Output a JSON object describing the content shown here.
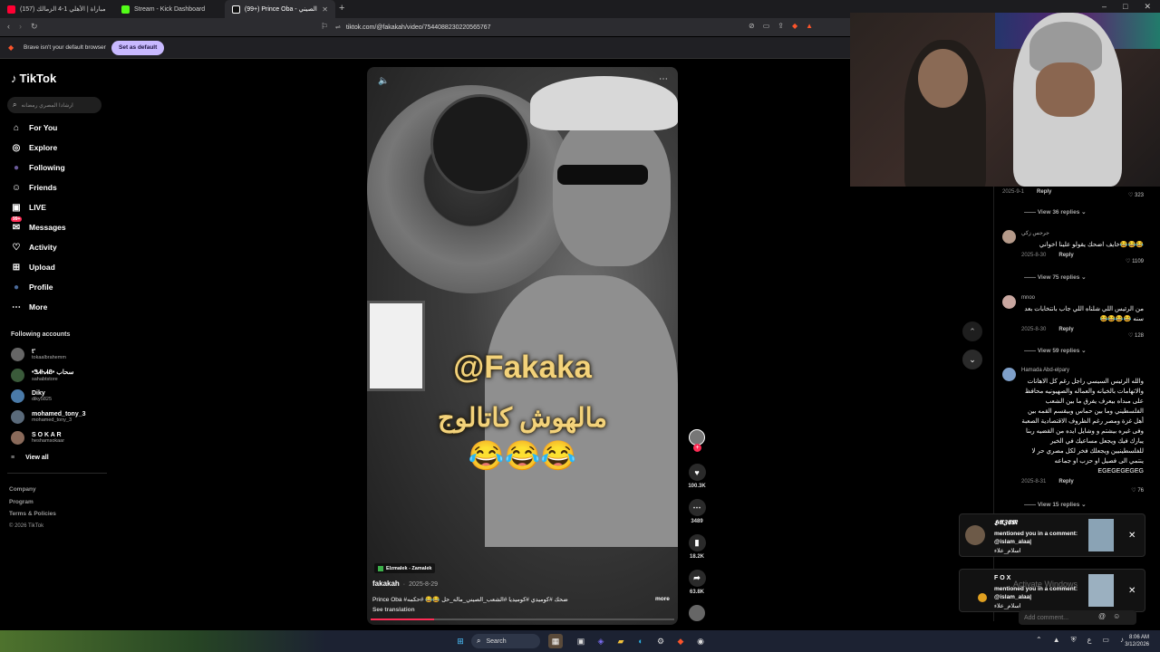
{
  "tabs": [
    {
      "label": "(157) ملخص مباراة | الأهلي 1-4 الزمالك",
      "color": "#ff0033"
    },
    {
      "label": "Stream - Kick Dashboard",
      "color": "#53fc18"
    },
    {
      "label": "(99+) Prince Oba - الشعب الصيني",
      "color": "#ffffff"
    }
  ],
  "url": "tiktok.com/@fakakah/video/7544088230220565767",
  "infobar": {
    "message": "Brave isn't your default browser",
    "button": "Set as default"
  },
  "tiktok": {
    "logo": "TikTok",
    "search_placeholder": "ارشادا المصري رمضانه",
    "nav": [
      {
        "label": "For You",
        "icon": "home-icon",
        "glyph": "⌂"
      },
      {
        "label": "Explore",
        "icon": "compass-icon",
        "glyph": "◎"
      },
      {
        "label": "Following",
        "icon": "following-avatar-icon",
        "glyph": "●"
      },
      {
        "label": "Friends",
        "icon": "friends-icon",
        "glyph": "☺"
      },
      {
        "label": "LIVE",
        "icon": "live-icon",
        "glyph": "▣"
      },
      {
        "label": "Messages",
        "icon": "messages-icon",
        "glyph": "✉",
        "badge": "99+"
      },
      {
        "label": "Activity",
        "icon": "activity-icon",
        "glyph": "♡"
      },
      {
        "label": "Upload",
        "icon": "upload-icon",
        "glyph": "⊞"
      },
      {
        "label": "Profile",
        "icon": "profile-icon",
        "glyph": "●"
      },
      {
        "label": "More",
        "icon": "more-icon",
        "glyph": "⋯"
      }
    ],
    "following_title": "Following accounts",
    "accounts": [
      {
        "name": "t'",
        "user": "tokaalbrahemm"
      },
      {
        "name": "•ᏕᏗᏂᏗᏰ• سحاب",
        "user": "sahabtstore"
      },
      {
        "name": "Diky",
        "user": "diky5825"
      },
      {
        "name": "mohamed_tony_3",
        "user": "mohamed_tony_3"
      },
      {
        "name": "S O K A R",
        "user": "heshamsokaar"
      }
    ],
    "view_all": "View all",
    "footer": [
      "Company",
      "Program",
      "Terms & Policies",
      "© 2026 TikTok"
    ]
  },
  "video": {
    "overlay_line1": "@Fakaka",
    "overlay_line2": "مالهوش كاتالوج",
    "overlay_emoji": "😂😂😂",
    "sticker": "Elzmalek - Zamalek",
    "author": "fakakah",
    "date": "2025-8-29",
    "caption": "Prince Oba #ضحك #كوميدي #كوميديا #الشعب_الصيني_ماله_حل 😂😂 #حكمه",
    "more": "more",
    "see_translation": "See translation",
    "likes": "100.3K",
    "comments": "3489",
    "saves": "18.2K",
    "shares": "63.8K"
  },
  "comments": {
    "top": {
      "date": "2025-9-1",
      "reply": "Reply",
      "likes": "323",
      "view_replies": "View 36 replies"
    },
    "items": [
      {
        "name": "جرجس زكي",
        "text": "😂😂😂خايف اضحك يقولو علينا اخواني",
        "date": "2025-8-30",
        "reply": "Reply",
        "likes": "1109",
        "view_replies": "View 75 replies"
      },
      {
        "name": "mnoo",
        "text": "من الرئيس اللي شلناه اللي جاب بانتخابات بعد سنه 😂😂😂😂",
        "date": "2025-8-30",
        "reply": "Reply",
        "likes": "128",
        "view_replies": "View 59 replies"
      },
      {
        "name": "Hamada Abd-elpary",
        "text": "والله الرئيس السيسي راجل رغم كل الاهانات والاتهامات بالخيانه والعماله والصهيونيه محافظ على مبداه بيعرف يفرق ما بين الشعب الفلسطيني وما بين حماس وبيقسم القمه بين أهل غزة ومصر رغم الظروف الاقتصادية الصعبة وفى غيره بيشتم و وشايل ايده من القضيه ربنا يبارك فيك ويجعل مساعيك في الخير للفلسطينيين ويجعلك فخر لكل مصري حر لا ينتمي الى فصيل او حزب او جماعه EGEGEGEGEG",
        "date": "2025-8-31",
        "reply": "Reply",
        "likes": "76",
        "view_replies": "View 15 replies"
      }
    ],
    "add_placeholder": "Add comment..."
  },
  "notifications": [
    {
      "name": "𝕳𝕬𝖅𝕰𝕸",
      "text": "mentioned you in a comment: @islam_alaa|",
      "sub": "اسلام_علاء"
    },
    {
      "name": "F O X",
      "text": "mentioned you in a comment: @islam_alaa|",
      "sub": "اسلام_علاء"
    }
  ],
  "watermark": "Activate Windows",
  "taskbar": {
    "search": "Search",
    "time": "8:06 AM",
    "date": "3/12/2026"
  }
}
